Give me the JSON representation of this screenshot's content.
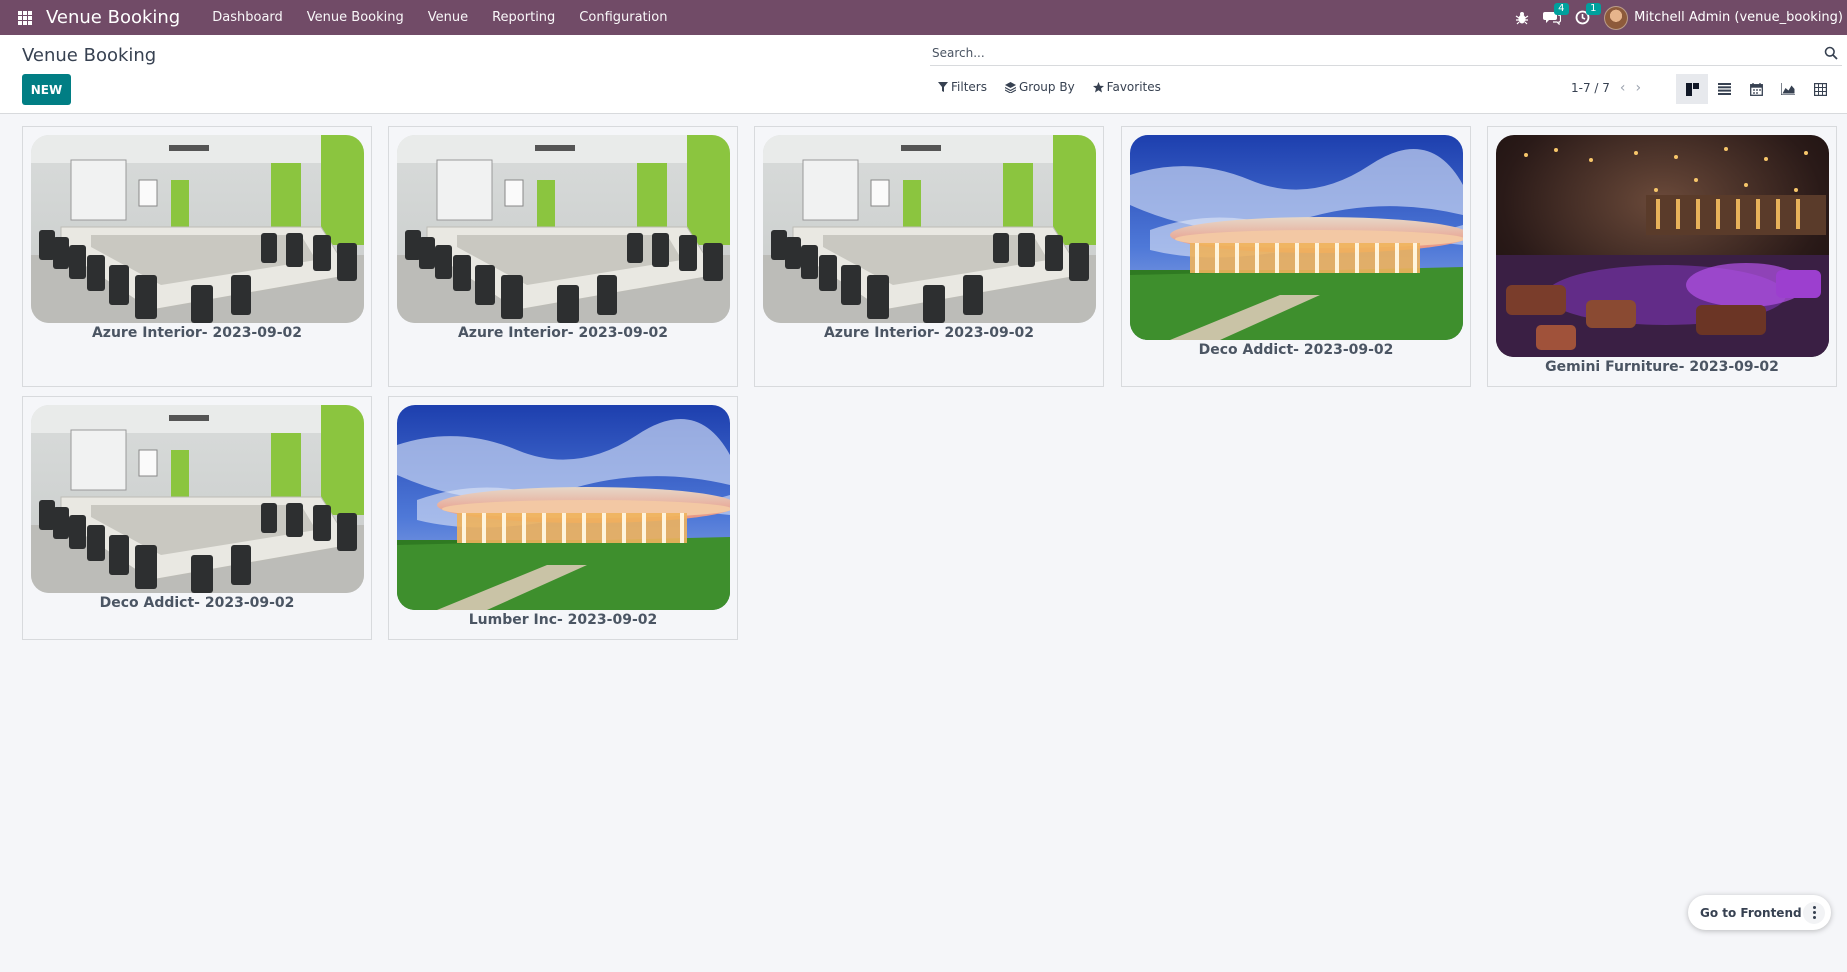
{
  "navbar": {
    "app_name": "Venue Booking",
    "menu": [
      "Dashboard",
      "Venue Booking",
      "Venue",
      "Reporting",
      "Configuration"
    ],
    "messages_count": "4",
    "activities_count": "1",
    "user": "Mitchell Admin (venue_booking)"
  },
  "control": {
    "breadcrumb": "Venue Booking",
    "new_label": "NEW",
    "search_placeholder": "Search...",
    "filters_label": "Filters",
    "groupby_label": "Group By",
    "favorites_label": "Favorites",
    "pager": "1-7 / 7"
  },
  "kanban": {
    "cards": [
      {
        "title": "Azure Interior- 2023-09-02",
        "image": "conference-room"
      },
      {
        "title": "Azure Interior- 2023-09-02",
        "image": "conference-room"
      },
      {
        "title": "Azure Interior- 2023-09-02",
        "image": "conference-room"
      },
      {
        "title": "Deco Addict- 2023-09-02",
        "image": "convention-center"
      },
      {
        "title": "Gemini Furniture- 2023-09-02",
        "image": "lounge-interior"
      },
      {
        "title": "Deco Addict- 2023-09-02",
        "image": "conference-room"
      },
      {
        "title": "Lumber Inc- 2023-09-02",
        "image": "convention-center"
      }
    ]
  },
  "floating": {
    "frontend_label": "Go to Frontend"
  },
  "colors": {
    "navbar": "#714b67",
    "primary_button": "#017e84",
    "badge": "#00a09d",
    "background": "#f5f6f9"
  }
}
